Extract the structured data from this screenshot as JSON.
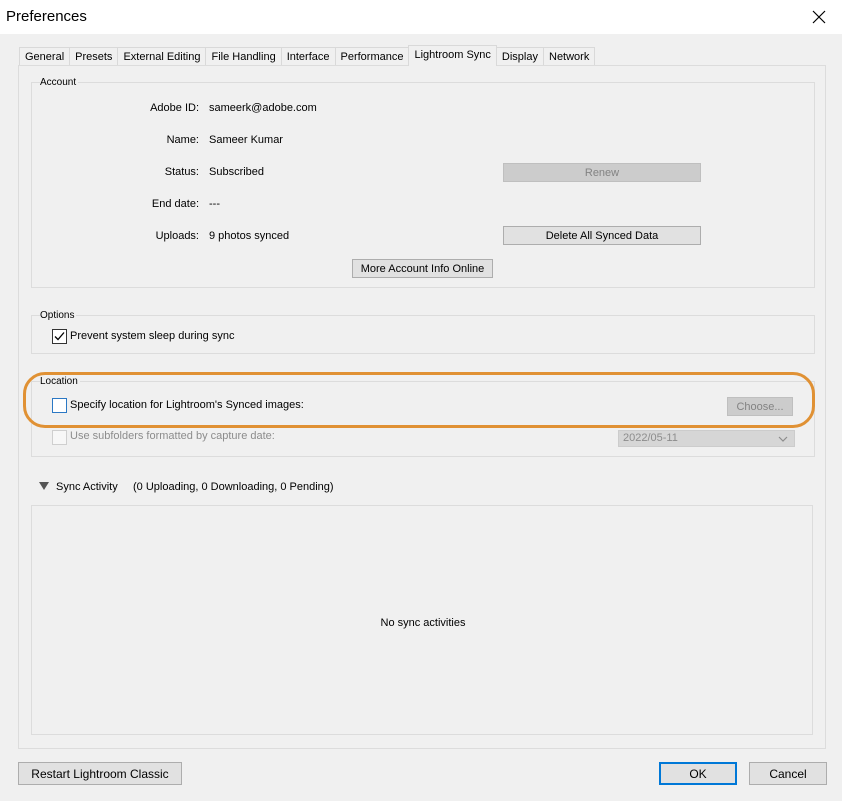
{
  "window": {
    "title": "Preferences"
  },
  "tabs": [
    {
      "label": "General",
      "active": false
    },
    {
      "label": "Presets",
      "active": false
    },
    {
      "label": "External Editing",
      "active": false
    },
    {
      "label": "File Handling",
      "active": false
    },
    {
      "label": "Interface",
      "active": false
    },
    {
      "label": "Performance",
      "active": false
    },
    {
      "label": "Lightroom Sync",
      "active": true
    },
    {
      "label": "Display",
      "active": false
    },
    {
      "label": "Network",
      "active": false
    }
  ],
  "account": {
    "group_label": "Account",
    "adobe_id_label": "Adobe ID:",
    "adobe_id": "sameerk@adobe.com",
    "name_label": "Name:",
    "name": "Sameer Kumar",
    "status_label": "Status:",
    "status": "Subscribed",
    "end_date_label": "End date:",
    "end_date": "---",
    "uploads_label": "Uploads:",
    "uploads": "9 photos synced",
    "renew_button": "Renew",
    "delete_button": "Delete All Synced Data",
    "more_info_button": "More Account Info Online"
  },
  "options": {
    "group_label": "Options",
    "prevent_sleep_label": "Prevent system sleep during sync",
    "prevent_sleep_checked": true
  },
  "location": {
    "group_label": "Location",
    "specify_label": "Specify location for Lightroom's Synced images:",
    "specify_checked": false,
    "choose_button": "Choose...",
    "subfolders_label": "Use subfolders formatted by capture date:",
    "subfolders_checked": false,
    "date_format": "2022/05-11"
  },
  "sync_activity": {
    "label": "Sync Activity",
    "summary": "(0 Uploading, 0 Downloading, 0 Pending)",
    "empty_text": "No sync activities"
  },
  "footer": {
    "restart_button": "Restart Lightroom Classic",
    "ok_button": "OK",
    "cancel_button": "Cancel"
  },
  "colors": {
    "highlight": "#e09134",
    "default_button_border": "#0078d7"
  }
}
